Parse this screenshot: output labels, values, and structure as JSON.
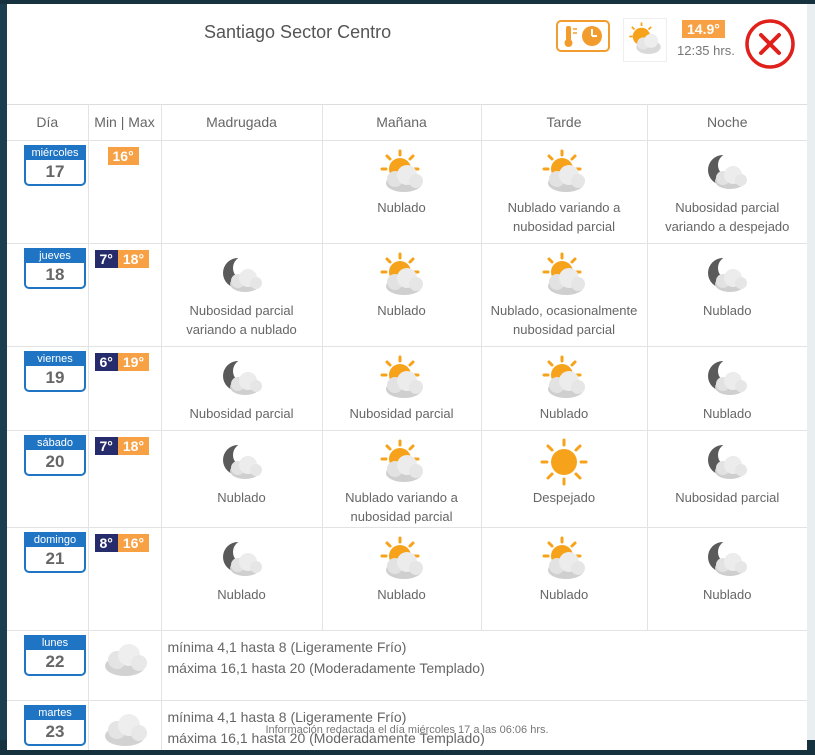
{
  "header": {
    "title": "Santiago Sector Centro",
    "current_temp": "14.9°",
    "current_time": "12:35 hrs."
  },
  "columns": [
    "Día",
    "Min | Max",
    "Madrugada",
    "Mañana",
    "Tarde",
    "Noche"
  ],
  "days": [
    {
      "name": "miércoles",
      "num": "17",
      "min": "",
      "max": "16°",
      "periods": [
        {
          "icon": "",
          "label": ""
        },
        {
          "icon": "sun-cloud-icon",
          "label": "Nublado"
        },
        {
          "icon": "sun-cloud-icon",
          "label": "Nublado variando a nubosidad parcial"
        },
        {
          "icon": "moon-cloud-icon",
          "label": "Nubosidad parcial variando a despejado"
        }
      ]
    },
    {
      "name": "jueves",
      "num": "18",
      "min": "7°",
      "max": "18°",
      "periods": [
        {
          "icon": "moon-cloud-icon",
          "label": "Nubosidad parcial variando a nublado"
        },
        {
          "icon": "sun-cloud-icon",
          "label": "Nublado"
        },
        {
          "icon": "sun-cloud-icon",
          "label": "Nublado, ocasionalmente nubosidad parcial"
        },
        {
          "icon": "moon-cloud-icon",
          "label": "Nublado"
        }
      ]
    },
    {
      "name": "viernes",
      "num": "19",
      "min": "6°",
      "max": "19°",
      "periods": [
        {
          "icon": "moon-cloud-icon",
          "label": "Nubosidad parcial"
        },
        {
          "icon": "sun-cloud-icon",
          "label": "Nubosidad parcial"
        },
        {
          "icon": "sun-cloud-icon",
          "label": "Nublado"
        },
        {
          "icon": "moon-cloud-icon",
          "label": "Nublado"
        }
      ]
    },
    {
      "name": "sábado",
      "num": "20",
      "min": "7°",
      "max": "18°",
      "periods": [
        {
          "icon": "moon-cloud-icon",
          "label": "Nublado"
        },
        {
          "icon": "sun-cloud-icon",
          "label": "Nublado variando a nubosidad parcial"
        },
        {
          "icon": "sun-icon",
          "label": "Despejado"
        },
        {
          "icon": "moon-cloud-icon",
          "label": "Nubosidad parcial"
        }
      ]
    },
    {
      "name": "domingo",
      "num": "21",
      "min": "8°",
      "max": "16°",
      "periods": [
        {
          "icon": "moon-cloud-icon",
          "label": "Nublado"
        },
        {
          "icon": "sun-cloud-icon",
          "label": "Nublado"
        },
        {
          "icon": "sun-cloud-icon",
          "label": "Nublado"
        },
        {
          "icon": "moon-cloud-icon",
          "label": "Nublado"
        }
      ]
    }
  ],
  "extended": [
    {
      "name": "lunes",
      "num": "22",
      "line1": "mínima 4,1 hasta 8 (Ligeramente Frío)",
      "line2": "máxima 16,1 hasta 20 (Moderadamente Templado)"
    },
    {
      "name": "martes",
      "num": "23",
      "line1": "mínima 4,1 hasta 8 (Ligeramente Frío)",
      "line2": "máxima 16,1 hasta 20 (Moderadamente Templado)"
    }
  ],
  "footer": "Información redactada el día miércoles 17 a las 06:06 hrs.",
  "colors": {
    "accent_blue": "#1f75c4",
    "min_temp": "#262c6b",
    "max_temp": "#f7a044",
    "close": "#e0201b"
  }
}
